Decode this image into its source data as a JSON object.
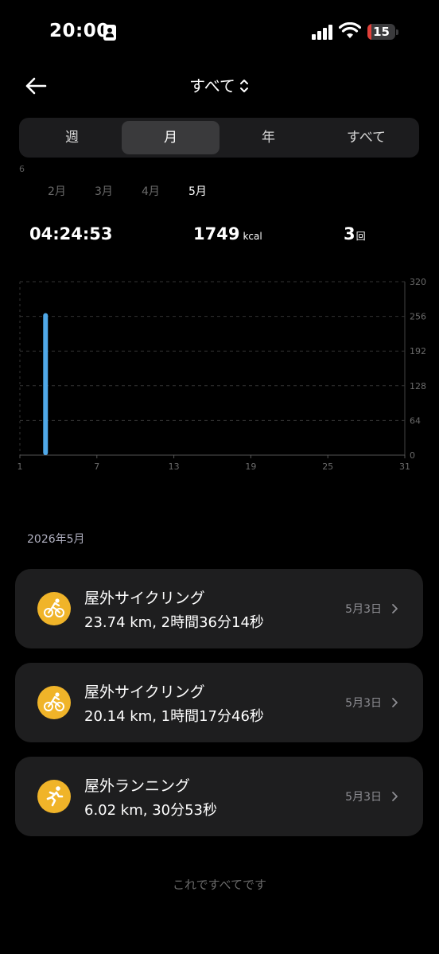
{
  "status_bar": {
    "time": "20:00",
    "battery": "15",
    "battery_level": 0.15
  },
  "header": {
    "title": "すべて",
    "back_icon": "arrow-left-icon",
    "toggle_icon": "chevron-up-down-icon"
  },
  "segments": [
    {
      "label": "週",
      "active": false
    },
    {
      "label": "月",
      "active": true
    },
    {
      "label": "年",
      "active": false
    },
    {
      "label": "すべて",
      "active": false
    }
  ],
  "months": {
    "edge_label": "6",
    "items": [
      {
        "label": "2月",
        "active": false
      },
      {
        "label": "3月",
        "active": false
      },
      {
        "label": "4月",
        "active": false
      },
      {
        "label": "5月",
        "active": true
      }
    ]
  },
  "stats": {
    "duration": "04:24:53",
    "calories": "1749",
    "calories_unit": "kcal",
    "count": "3",
    "count_unit": "回"
  },
  "chart_data": {
    "type": "bar",
    "x_ticks": [
      "1",
      "7",
      "13",
      "19",
      "25",
      "31"
    ],
    "y_ticks": [
      "0",
      "64",
      "128",
      "192",
      "256",
      "320"
    ],
    "xlim": [
      1,
      31
    ],
    "ylim": [
      0,
      320
    ],
    "bars": [
      {
        "day": 3,
        "value": 262
      }
    ],
    "bar_color": "#4fa8e8",
    "grid": true
  },
  "list": {
    "section_title": "2026年5月",
    "items": [
      {
        "title": "屋外サイクリング",
        "detail": "23.74 km, 2時間36分14秒",
        "date": "5月3日",
        "icon": "cycling-icon"
      },
      {
        "title": "屋外サイクリング",
        "detail": "20.14 km, 1時間17分46秒",
        "date": "5月3日",
        "icon": "cycling-icon"
      },
      {
        "title": "屋外ランニング",
        "detail": "6.02 km, 30分53秒",
        "date": "5月3日",
        "icon": "running-icon"
      }
    ],
    "accent_color": "#f0b429"
  },
  "footer": {
    "text": "これですべてです"
  }
}
